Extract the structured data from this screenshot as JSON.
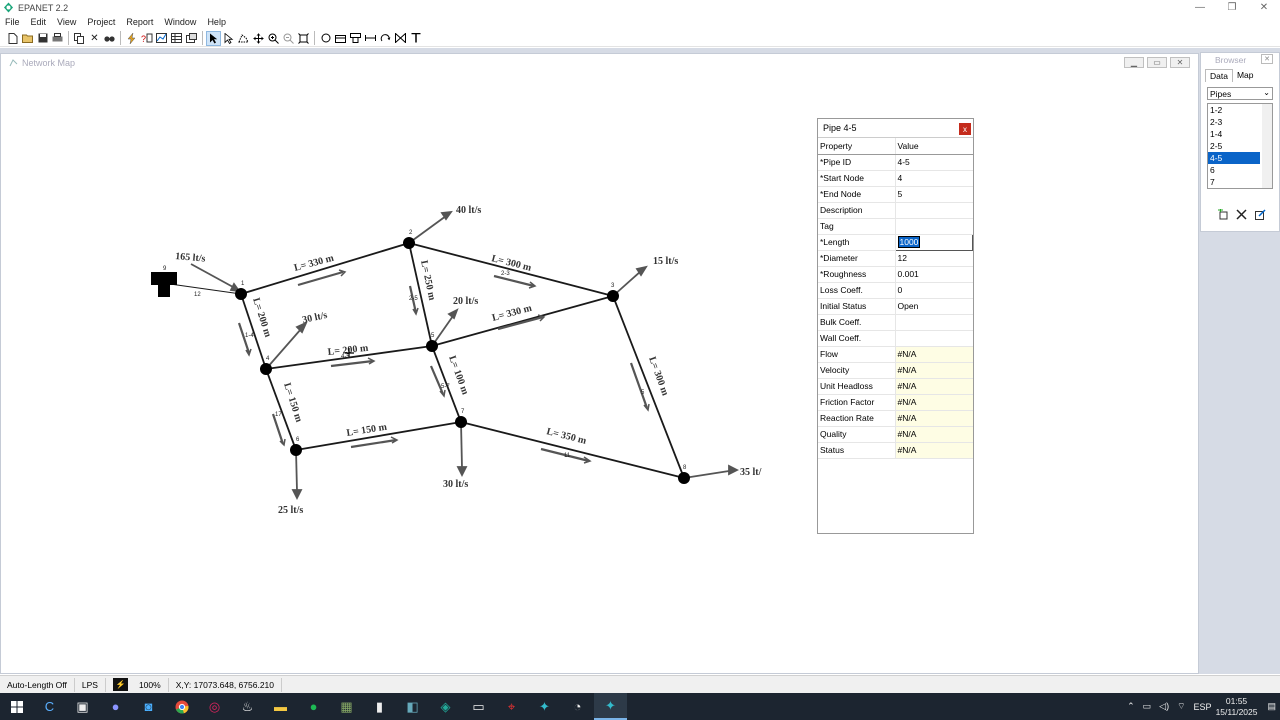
{
  "window": {
    "title": "EPANET 2.2",
    "controls": [
      "—",
      "❐",
      "✕"
    ]
  },
  "menu": [
    "File",
    "Edit",
    "View",
    "Project",
    "Report",
    "Window",
    "Help"
  ],
  "toolbar": {
    "group1": [
      "new-icon",
      "open-icon",
      "save-icon",
      "print-icon",
      "copy-icon",
      "delete-icon",
      "find-icon"
    ],
    "group2": [
      "run-icon",
      "query-icon",
      "graph-icon",
      "table-icon",
      "options-icon"
    ],
    "group3": [
      "select-object-icon",
      "select-vertex-icon",
      "select-region-icon",
      "pan-icon",
      "zoom-in-icon",
      "zoom-out-icon",
      "full-extent-icon"
    ],
    "group4": [
      "add-junction-icon",
      "add-reservoir-icon",
      "add-tank-icon",
      "add-pipe-icon",
      "add-pump-icon",
      "add-valve-icon",
      "add-label-icon"
    ]
  },
  "network_map": {
    "title": "Network Map",
    "accent": "#0a64c8",
    "node_ids": [
      "1",
      "2",
      "3",
      "4",
      "5",
      "6",
      "7",
      "8",
      "9"
    ],
    "pipe_ids": [
      "12",
      "1-4",
      "2-3",
      "2-5",
      "4-5",
      "5-7",
      "5",
      "17",
      "11"
    ],
    "underlay_labels": {
      "pipe_1_2": "L= 330 m",
      "pipe_2_3": "L= 300 m",
      "pipe_2_5": "L= 250 m",
      "pipe_1_4": "L= 200 m",
      "pipe_5_3": "L= 330 m",
      "pipe_4_5": "L= 200 m",
      "pipe_5_7": "L= 100 m",
      "pipe_3_8": "L= 300 m",
      "pipe_4_6": "L= 150 m",
      "pipe_6_7": "L= 150 m",
      "pipe_7_8": "L= 350 m",
      "demand_2": "40 lt/s",
      "demand_3": "15 lt/s",
      "demand_4": "30 lt/s",
      "demand_5": "20 lt/s",
      "demand_6": "25 lt/s",
      "demand_7": "30 lt/s",
      "demand_8": "35 lt/",
      "supply_9": "165 lt/s"
    }
  },
  "property_editor": {
    "title": "Pipe 4-5",
    "close": "x",
    "header": {
      "property": "Property",
      "value": "Value"
    },
    "rows": [
      {
        "k": "*Pipe ID",
        "v": "4-5"
      },
      {
        "k": "*Start Node",
        "v": "4"
      },
      {
        "k": "*End Node",
        "v": "5"
      },
      {
        "k": "Description",
        "v": ""
      },
      {
        "k": "Tag",
        "v": ""
      },
      {
        "k": "*Length",
        "v": "1000"
      },
      {
        "k": "*Diameter",
        "v": "12"
      },
      {
        "k": "*Roughness",
        "v": "0.001"
      },
      {
        "k": "Loss Coeff.",
        "v": "0"
      },
      {
        "k": "Initial Status",
        "v": "Open"
      },
      {
        "k": "Bulk Coeff.",
        "v": ""
      },
      {
        "k": "Wall Coeff.",
        "v": ""
      },
      {
        "k": "Flow",
        "v": "#N/A"
      },
      {
        "k": "Velocity",
        "v": "#N/A"
      },
      {
        "k": "Unit Headloss",
        "v": "#N/A"
      },
      {
        "k": "Friction Factor",
        "v": "#N/A"
      },
      {
        "k": "Reaction Rate",
        "v": "#N/A"
      },
      {
        "k": "Quality",
        "v": "#N/A"
      },
      {
        "k": "Status",
        "v": "#N/A"
      }
    ]
  },
  "browser": {
    "title": "Browser",
    "tabs": [
      "Data",
      "Map"
    ],
    "category": "Pipes",
    "items": [
      "1-2",
      "2-3",
      "1-4",
      "2-5",
      "4-5",
      "6",
      "7"
    ],
    "selected_index": 4
  },
  "statusbar": {
    "auto_length": "Auto-Length Off",
    "units": "LPS",
    "zoom": "100%",
    "coords": "X,Y: 17073.648, 6756.210"
  },
  "taskbar": {
    "tray_lang": "ESP",
    "time": "01:55",
    "date": "15/11/2025"
  }
}
